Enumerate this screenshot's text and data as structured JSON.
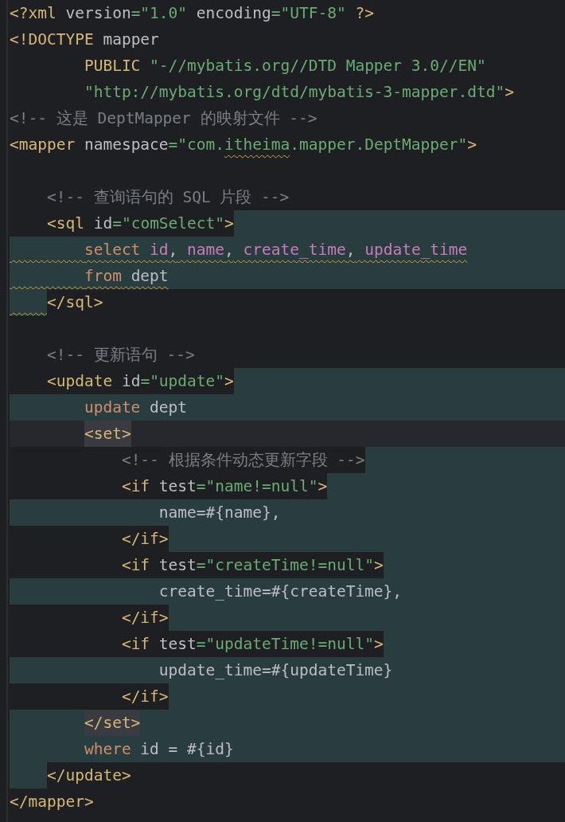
{
  "editor": {
    "lines": [
      {
        "kind": "plain",
        "tokens": [
          {
            "kind": "tag",
            "text": "<?xml"
          },
          {
            "kind": "attr",
            "text": " version"
          },
          {
            "kind": "string",
            "text": "=\"1.0\""
          },
          {
            "kind": "attr",
            "text": " encoding"
          },
          {
            "kind": "string",
            "text": "=\"UTF-8\""
          },
          {
            "kind": "tag",
            "text": " ?>"
          }
        ]
      },
      {
        "kind": "plain",
        "tokens": [
          {
            "kind": "tag",
            "text": "<!DOCTYPE"
          },
          {
            "kind": "text",
            "text": " mapper"
          }
        ]
      },
      {
        "kind": "plain",
        "tokens": [
          {
            "kind": "tag",
            "text": "        PUBLIC"
          },
          {
            "kind": "string",
            "text": " \"-//mybatis.org//DTD Mapper 3.0//EN\""
          }
        ]
      },
      {
        "kind": "plain",
        "tokens": [
          {
            "kind": "string",
            "text": "        \"http://mybatis.org/dtd/mybatis-3-mapper.dtd\""
          },
          {
            "kind": "tag",
            "text": ">"
          }
        ]
      },
      {
        "kind": "plain",
        "tokens": [
          {
            "kind": "comment",
            "text": "<!-- 这是 DeptMapper 的映射文件 -->"
          }
        ]
      },
      {
        "kind": "plain",
        "tokens": [
          {
            "kind": "tag",
            "text": "<mapper"
          },
          {
            "kind": "attr",
            "text": " namespace"
          },
          {
            "kind": "string",
            "text": "=\"com."
          },
          {
            "kind": "string",
            "text": "itheima",
            "warning": true
          },
          {
            "kind": "string",
            "text": ".mapper.DeptMapper\""
          },
          {
            "kind": "tag",
            "text": ">"
          }
        ]
      },
      {
        "kind": "plain"
      },
      {
        "kind": "plain",
        "tokens": [
          {
            "kind": "comment",
            "text": "    <!-- 查询语句的 SQL 片段 -->"
          }
        ]
      },
      {
        "kind": "highlighted",
        "tokens": [
          {
            "kind": "tag",
            "text": "    <sql",
            "boxed": true
          },
          {
            "kind": "attr",
            "text": " id",
            "boxed": true
          },
          {
            "kind": "string",
            "text": "=\"comSelect\"",
            "boxed": true
          },
          {
            "kind": "tag",
            "text": ">",
            "boxed": true
          }
        ]
      },
      {
        "kind": "highlighted",
        "indent_warning": true,
        "tokens": [
          {
            "kind": "keyword",
            "text": "        select",
            "warning": true
          },
          {
            "kind": "column",
            "text": " id",
            "warning": true
          },
          {
            "kind": "text",
            "text": ",",
            "warning": true
          },
          {
            "kind": "column",
            "text": " name",
            "warning": true
          },
          {
            "kind": "text",
            "text": ",",
            "warning": true
          },
          {
            "kind": "column",
            "text": " create_time",
            "warning": true
          },
          {
            "kind": "text",
            "text": ",",
            "warning": true
          },
          {
            "kind": "column",
            "text": " update_time",
            "warning": true
          }
        ]
      },
      {
        "kind": "highlighted",
        "indent_warning": true,
        "tokens": [
          {
            "kind": "keyword",
            "text": "        from",
            "warning": true
          },
          {
            "kind": "text",
            "text": " dept",
            "warning": true
          }
        ]
      },
      {
        "kind": "guttered",
        "indent_warning": true,
        "tokens": [
          {
            "kind": "tag",
            "text": "    </sql>"
          }
        ]
      },
      {
        "kind": "plain"
      },
      {
        "kind": "plain",
        "tokens": [
          {
            "kind": "comment",
            "text": "    <!-- 更新语句 -->"
          }
        ]
      },
      {
        "kind": "highlighted",
        "tokens": [
          {
            "kind": "tag",
            "text": "    <update",
            "boxed": true
          },
          {
            "kind": "attr",
            "text": " id",
            "boxed": true
          },
          {
            "kind": "string",
            "text": "=\"update\"",
            "boxed": true
          },
          {
            "kind": "tag",
            "text": ">",
            "boxed": true
          }
        ]
      },
      {
        "kind": "highlighted",
        "tokens": [
          {
            "kind": "keyword",
            "text": "        update"
          },
          {
            "kind": "text",
            "text": " dept"
          }
        ]
      },
      {
        "kind": "current",
        "tokens": [
          {
            "kind": "tag",
            "text": "        <set>",
            "matched": true
          }
        ]
      },
      {
        "kind": "highlighted",
        "tokens": [
          {
            "kind": "comment",
            "text": "            <!-- 根据条件动态更新字段 -->",
            "boxed": true
          }
        ]
      },
      {
        "kind": "highlighted",
        "tokens": [
          {
            "kind": "tag",
            "text": "            <if",
            "boxed": true
          },
          {
            "kind": "attr",
            "text": " test",
            "boxed": true
          },
          {
            "kind": "string",
            "text": "=\"name!=null\"",
            "boxed": true
          },
          {
            "kind": "tag",
            "text": ">",
            "boxed": true
          }
        ]
      },
      {
        "kind": "highlighted",
        "tokens": [
          {
            "kind": "text",
            "text": "                name=#{name},"
          }
        ]
      },
      {
        "kind": "highlighted",
        "tokens": [
          {
            "kind": "tag",
            "text": "            </if>",
            "boxed": true
          }
        ]
      },
      {
        "kind": "highlighted",
        "tokens": [
          {
            "kind": "tag",
            "text": "            <if",
            "boxed": true
          },
          {
            "kind": "attr",
            "text": " test",
            "boxed": true
          },
          {
            "kind": "string",
            "text": "=\"createTime!=null\"",
            "boxed": true
          },
          {
            "kind": "tag",
            "text": ">",
            "boxed": true
          }
        ]
      },
      {
        "kind": "highlighted",
        "tokens": [
          {
            "kind": "text",
            "text": "                create_time=#{createTime},"
          }
        ]
      },
      {
        "kind": "highlighted",
        "tokens": [
          {
            "kind": "tag",
            "text": "            </if>",
            "boxed": true
          }
        ]
      },
      {
        "kind": "highlighted",
        "tokens": [
          {
            "kind": "tag",
            "text": "            <if",
            "boxed": true
          },
          {
            "kind": "attr",
            "text": " test",
            "boxed": true
          },
          {
            "kind": "string",
            "text": "=\"updateTime!=null\"",
            "boxed": true
          },
          {
            "kind": "tag",
            "text": ">",
            "boxed": true
          }
        ]
      },
      {
        "kind": "highlighted",
        "tokens": [
          {
            "kind": "text",
            "text": "                update_time=#{updateTime}"
          }
        ]
      },
      {
        "kind": "highlighted",
        "tokens": [
          {
            "kind": "tag",
            "text": "            </if>",
            "boxed": true
          }
        ]
      },
      {
        "kind": "highlighted",
        "tokens": [
          {
            "kind": "tag",
            "text": "        </set>",
            "matched": true
          }
        ]
      },
      {
        "kind": "highlighted",
        "tokens": [
          {
            "kind": "keyword",
            "text": "        where"
          },
          {
            "kind": "text",
            "text": " id = #{id}"
          }
        ]
      },
      {
        "kind": "guttered",
        "tokens": [
          {
            "kind": "tag",
            "text": "    </update>"
          }
        ]
      },
      {
        "kind": "plain",
        "tokens": [
          {
            "kind": "tag",
            "text": "</mapper>"
          }
        ]
      }
    ]
  }
}
